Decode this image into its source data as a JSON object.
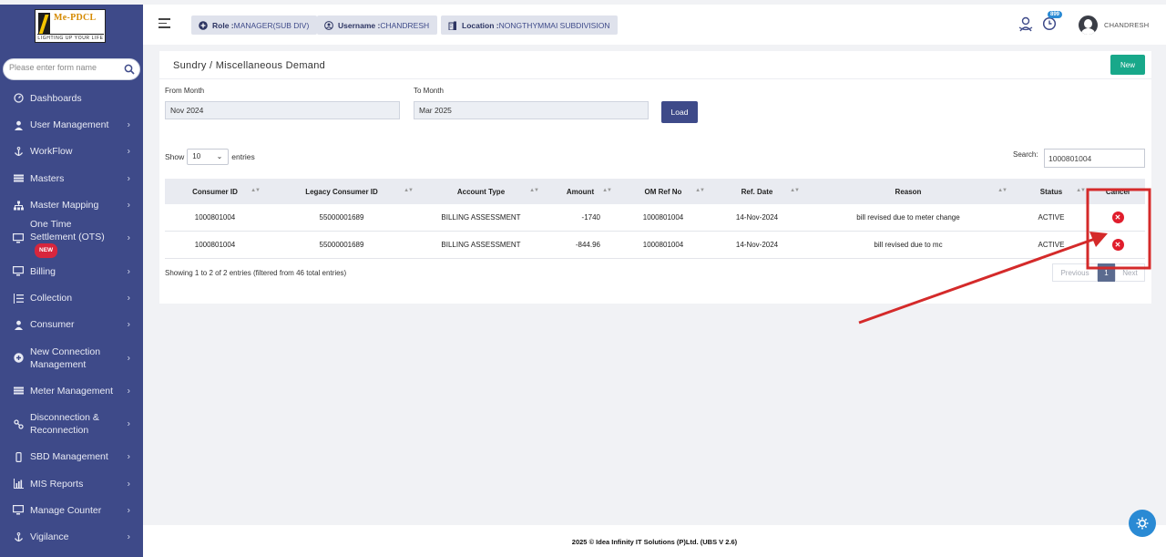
{
  "brand": {
    "name": "Me-PDCL",
    "tagline": "LIGHTING UP YOUR LIFE"
  },
  "sidebar": {
    "search_placeholder": "Please enter form name",
    "items": [
      {
        "label": "Dashboards",
        "icon": "dashboard-icon"
      },
      {
        "label": "User Management",
        "icon": "user-icon"
      },
      {
        "label": "WorkFlow",
        "icon": "anchor-icon"
      },
      {
        "label": "Masters",
        "icon": "list-icon"
      },
      {
        "label": "Master Mapping",
        "icon": "sitemap-icon"
      },
      {
        "label": "One Time Settlement (OTS)",
        "icon": "monitor-icon",
        "badge": "NEW"
      },
      {
        "label": "Billing",
        "icon": "monitor-icon"
      },
      {
        "label": "Collection",
        "icon": "list-check-icon"
      },
      {
        "label": "Consumer",
        "icon": "user-icon"
      },
      {
        "label": "New Connection Management",
        "icon": "plus-circle-icon"
      },
      {
        "label": "Meter Management",
        "icon": "list-icon"
      },
      {
        "label": "Disconnection & Reconnection",
        "icon": "link-icon"
      },
      {
        "label": "SBD Management",
        "icon": "mobile-icon"
      },
      {
        "label": "MIS Reports",
        "icon": "bar-chart-icon"
      },
      {
        "label": "Manage Counter",
        "icon": "monitor-icon"
      },
      {
        "label": "Vigilance",
        "icon": "anchor-icon"
      }
    ]
  },
  "topbar": {
    "role_label": "Role :",
    "role_value": "MANAGER(SUB DIV)",
    "username_label": "Username :",
    "username_value": "CHANDRESH",
    "location_label": "Location :",
    "location_value": "NONGTHYMMAI SUBDIVISION",
    "notification_count": "899",
    "user_display": "CHANDRESH"
  },
  "page": {
    "title": "Sundry / Miscellaneous Demand",
    "new_button": "New",
    "from_month_label": "From Month",
    "from_month_value": "Nov 2024",
    "to_month_label": "To Month",
    "to_month_value": "Mar 2025",
    "load_button": "Load",
    "show_label": "Show",
    "entries_label": "entries",
    "page_size": "10",
    "search_label": "Search:",
    "search_value": "1000801004"
  },
  "table": {
    "columns": [
      "Consumer ID",
      "Legacy Consumer ID",
      "Account Type",
      "Amount",
      "OM Ref No",
      "Ref. Date",
      "Reason",
      "Status",
      "Cancel"
    ],
    "rows": [
      {
        "consumer_id": "1000801004",
        "legacy_id": "55000001689",
        "account_type": "BILLING ASSESSMENT",
        "amount": "-1740",
        "om_ref_no": "1000801004",
        "ref_date": "14-Nov-2024",
        "reason": "bill revised due to meter change",
        "status": "ACTIVE"
      },
      {
        "consumer_id": "1000801004",
        "legacy_id": "55000001689",
        "account_type": "BILLING ASSESSMENT",
        "amount": "-844.96",
        "om_ref_no": "1000801004",
        "ref_date": "14-Nov-2024",
        "reason": "bill revised due to mc",
        "status": "ACTIVE"
      }
    ],
    "info": "Showing 1 to 2 of 2 entries (filtered from 46 total entries)",
    "pager": {
      "previous": "Previous",
      "current": "1",
      "next": "Next"
    }
  },
  "footer": {
    "text": "2025 © Idea Infinity IT Solutions (P)Ltd. (UBS V 2.6)"
  },
  "colors": {
    "sidebar_bg": "#3e4a89",
    "accent_green": "#18a88a",
    "cancel_red": "#e01d2c",
    "annotation_red": "#d42a2a",
    "fab_blue": "#2a8ad4"
  }
}
